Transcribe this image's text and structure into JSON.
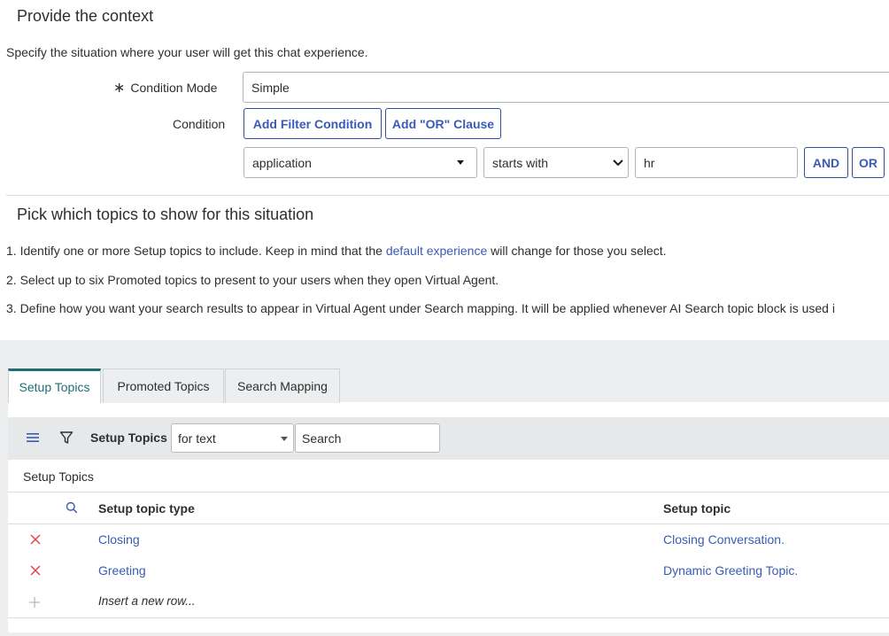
{
  "context": {
    "title": "Provide the context",
    "description": "Specify the situation where your user will get this chat experience.",
    "condition_mode_required": "∗",
    "condition_mode_label": "Condition Mode",
    "condition_mode_value": "Simple",
    "condition_label": "Condition",
    "add_filter_label": "Add Filter Condition",
    "add_or_label": "Add \"OR\" Clause",
    "field_value": "application",
    "operator_value": "starts with",
    "value_text": "hr",
    "and_label": "AND",
    "or_label": "OR"
  },
  "topics": {
    "title": "Pick which topics to show for this situation",
    "step1_prefix": "1. Identify one or more Setup topics to include. Keep in mind that the ",
    "step1_link": "default experience",
    "step1_suffix": " will change for those you select.",
    "step2": "2. Select up to six Promoted topics to present to your users when they open Virtual Agent.",
    "step3": "3. Define how you want your search results to appear in Virtual Agent under Search mapping. It will be applied whenever AI Search topic block is used i"
  },
  "tabs": [
    {
      "label": "Setup Topics",
      "active": true
    },
    {
      "label": "Promoted Topics",
      "active": false
    },
    {
      "label": "Search Mapping",
      "active": false
    }
  ],
  "list": {
    "toolbar_title": "Setup Topics",
    "search_field_option": "for text",
    "search_placeholder": "Search",
    "caption": "Setup Topics",
    "columns": [
      "Setup topic type",
      "Setup topic"
    ],
    "rows": [
      {
        "type": "Closing",
        "topic": "Closing Conversation."
      },
      {
        "type": "Greeting",
        "topic": "Dynamic Greeting Topic."
      }
    ],
    "insert_label": "Insert a new row..."
  },
  "colors": {
    "link": "#3a5bb5",
    "active_tab": "#1e6f73",
    "delete": "#e0444a"
  },
  "icons": [
    "hamburger-menu-icon",
    "filter-icon",
    "search-icon",
    "delete-icon",
    "add-icon",
    "chevron-down-icon"
  ]
}
